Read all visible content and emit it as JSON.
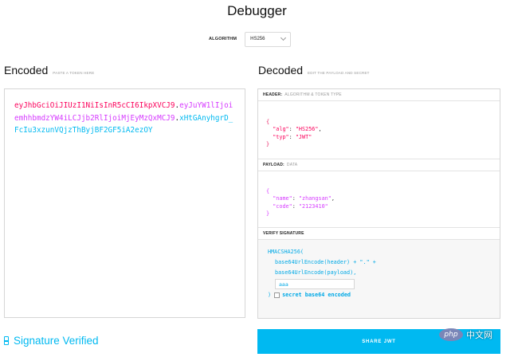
{
  "page": {
    "title": "Debugger"
  },
  "algorithm": {
    "label": "ALGORITHM",
    "value": "HS256"
  },
  "encoded": {
    "title": "Encoded",
    "hint": "PASTE A TOKEN HERE",
    "header_part": "eyJhbGciOiJIUzI1NiIsInR5cCI6IkpXVCJ9",
    "payload_part": "eyJuYW1lIjoiemhhbmdzYW4iLCJjb2RlIjoiMjEyMzQxMCJ9",
    "signature_part": "xHtGAnyhgrD_FcIu3xzunVQjzThByjBF2GF5iA2ezOY",
    "dot": "."
  },
  "decoded": {
    "title": "Decoded",
    "hint": "EDIT THE PAYLOAD AND SECRET",
    "header_section": {
      "label": "HEADER:",
      "sub": "ALGORITHM & TOKEN TYPE",
      "alg_key": "\"alg\"",
      "alg_value": "\"HS256\"",
      "typ_key": "\"typ\"",
      "typ_value": "\"JWT\""
    },
    "payload_section": {
      "label": "PAYLOAD:",
      "sub": "DATA",
      "name_key": "\"name\"",
      "name_value": "\"zhangsan\"",
      "code_key": "\"code\"",
      "code_value": "\"2123410\""
    },
    "verify_section": {
      "label": "VERIFY SIGNATURE",
      "fn": "HMACSHA256(",
      "line1": "base64UrlEncode(header) + \".\" +",
      "line2": "base64UrlEncode(payload),",
      "secret_value": "aaa",
      "close": ")",
      "checkbox_label": "secret base64 encoded"
    }
  },
  "status": {
    "verified_text": "Signature Verified"
  },
  "share": {
    "label": "SHARE JWT"
  },
  "watermark": {
    "badge": "php",
    "text": "中文网"
  },
  "colors": {
    "header": "#fb015b",
    "payload": "#d63aff",
    "signature": "#00b9f1",
    "accent": "#00b9f1"
  }
}
